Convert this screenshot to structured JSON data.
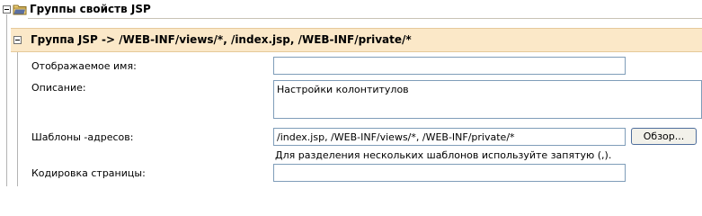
{
  "section": {
    "title": "Группы свойств JSP"
  },
  "group": {
    "title": "Группа JSP -> /WEB-INF/views/*, /index.jsp, /WEB-INF/private/*"
  },
  "form": {
    "display_name": {
      "label": "Отображаемое имя:",
      "value": ""
    },
    "description": {
      "label": "Описание:",
      "value": "Настройки колонтитулов"
    },
    "url_patterns": {
      "label": "Шаблоны -адресов:",
      "value": "/index.jsp, /WEB-INF/views/*, /WEB-INF/private/*",
      "browse_label": "Обзор...",
      "hint": "Для разделения нескольких шаблонов используйте запятую (,)."
    },
    "page_encoding": {
      "label": "Кодировка страницы:",
      "value": ""
    }
  },
  "colors": {
    "group_bar_bg": "#fbe8c8",
    "field_border": "#7f9db9"
  }
}
